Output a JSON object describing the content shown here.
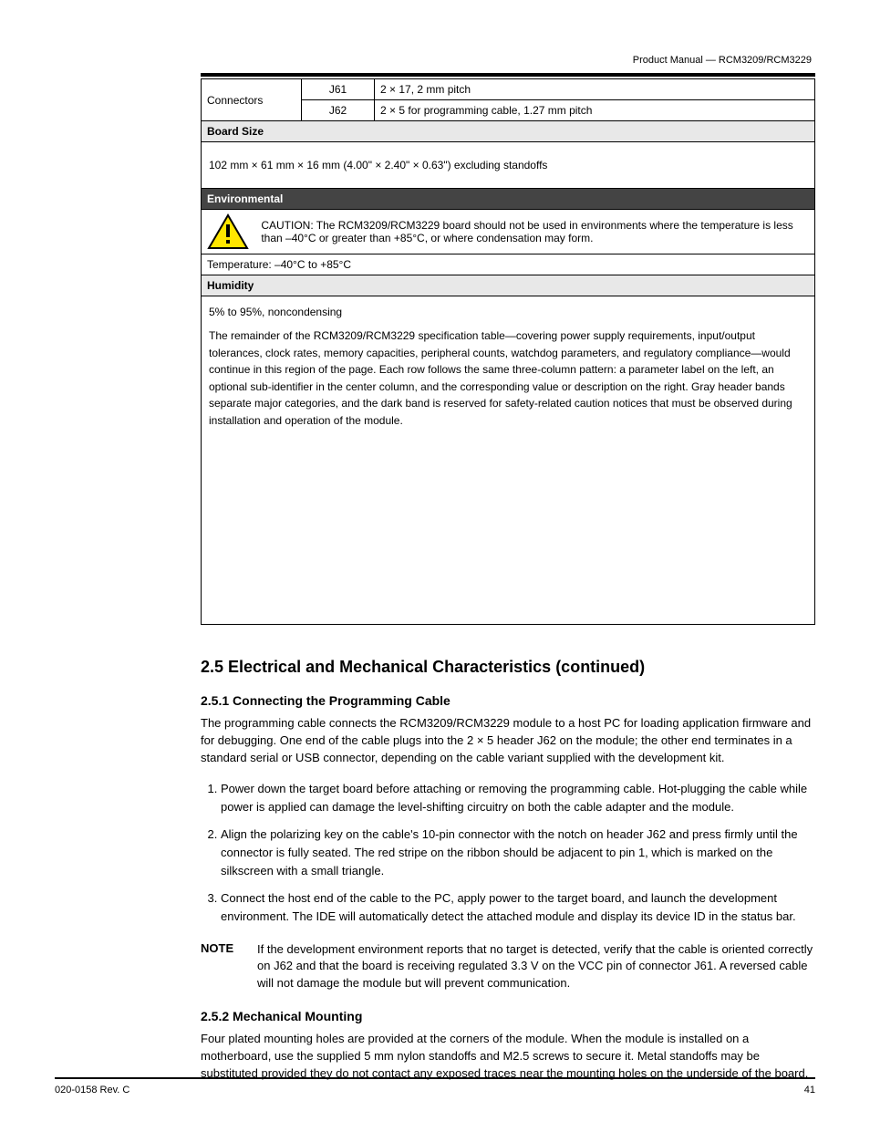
{
  "header": {
    "right": "Product Manual — RCM3209/RCM3229"
  },
  "table": {
    "rowlabel": "Connectors",
    "r1_mid": "J61",
    "r1_right": "2 × 17, 2 mm pitch",
    "r2_mid": "J62",
    "r2_right": "2 × 5 for programming cable, 1.27 mm pitch",
    "size_header": "Board Size",
    "size_text": "102 mm × 61 mm × 16 mm (4.00\" × 2.40\" × 0.63\") excluding standoffs",
    "env_header": "Environmental",
    "warn_text": "CAUTION: The RCM3209/RCM3229 board should not be used in environments where the temperature is less than –40°C or greater than +85°C, or where condensation may form.",
    "temp_row": "Temperature: –40°C to +85°C",
    "humidity_header": "Humidity",
    "humidity_text": "5% to 95%, noncondensing",
    "large_body": "The remainder of the RCM3209/RCM3229 specification table—covering power supply requirements, input/output tolerances, clock rates, memory capacities, peripheral counts, watchdog parameters, and regulatory compliance—would continue in this region of the page. Each row follows the same three-column pattern: a parameter label on the left, an optional sub-identifier in the center column, and the corresponding value or description on the right. Gray header bands separate major categories, and the dark band is reserved for safety-related caution notices that must be observed during installation and operation of the module."
  },
  "section": {
    "title": "2.5  Electrical and Mechanical Characteristics (continued)"
  },
  "sub1": {
    "title": "2.5.1  Connecting the Programming Cable",
    "p1": "The programming cable connects the RCM3209/RCM3229 module to a host PC for loading application firmware and for debugging. One end of the cable plugs into the 2 × 5 header J62 on the module; the other end terminates in a standard serial or USB connector, depending on the cable variant supplied with the development kit.",
    "steps": [
      "Power down the target board before attaching or removing the programming cable. Hot-plugging the cable while power is applied can damage the level-shifting circuitry on both the cable adapter and the module.",
      "Align the polarizing key on the cable's 10-pin connector with the notch on header J62 and press firmly until the connector is fully seated. The red stripe on the ribbon should be adjacent to pin 1, which is marked on the silkscreen with a small triangle.",
      "Connect the host end of the cable to the PC, apply power to the target board, and launch the development environment. The IDE will automatically detect the attached module and display its device ID in the status bar."
    ]
  },
  "note": {
    "label": "NOTE",
    "text": "If the development environment reports that no target is detected, verify that the cable is oriented correctly on J62 and that the board is receiving regulated 3.3 V on the VCC pin of connector J61. A reversed cable will not damage the module but will prevent communication."
  },
  "sub2": {
    "title": "2.5.2  Mechanical Mounting",
    "p1": "Four plated mounting holes are provided at the corners of the module. When the module is installed on a motherboard, use the supplied 5 mm nylon standoffs and M2.5 screws to secure it. Metal standoffs may be substituted provided they do not contact any exposed traces near the mounting holes on the underside of the board."
  },
  "footer": {
    "left": "020-0158 Rev. C",
    "right": "41"
  }
}
